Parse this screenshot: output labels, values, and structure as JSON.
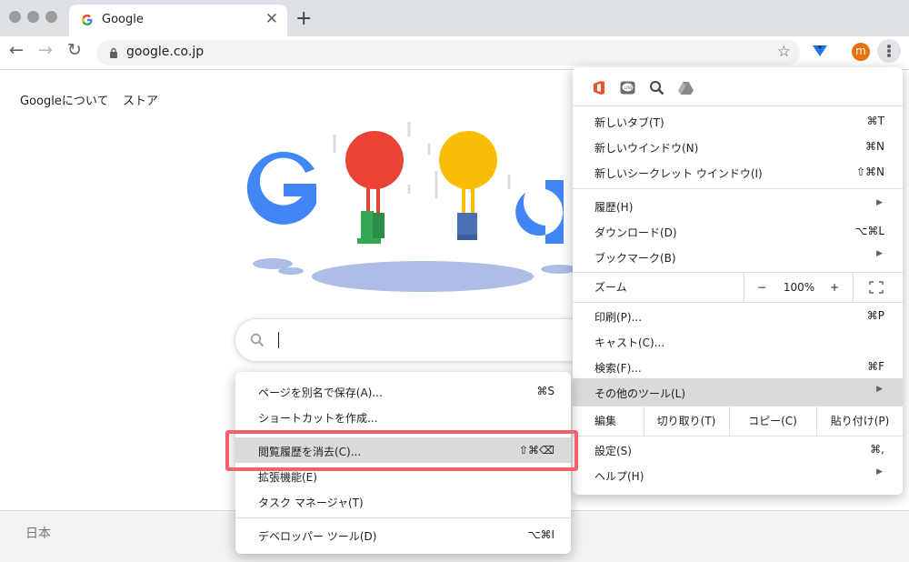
{
  "browser": {
    "tab": {
      "title": "Google",
      "close": "✕"
    },
    "new_tab": "+",
    "toolbar": {
      "back": "←",
      "forward": "→",
      "reload": "↻"
    },
    "omnibox": {
      "url": "google.co.jp",
      "star": "☆"
    },
    "avatar": "m"
  },
  "page": {
    "links": {
      "about": "Googleについて",
      "store": "ストア"
    },
    "footer": {
      "country": "日本"
    }
  },
  "chrome_menu": {
    "extension_icons": [
      "office-icon",
      "line-icon",
      "magnifier-icon",
      "drive-icon"
    ],
    "new_tab": {
      "label": "新しいタブ(T)",
      "shortcut": "⌘T"
    },
    "new_window": {
      "label": "新しいウインドウ(N)",
      "shortcut": "⌘N"
    },
    "new_incognito": {
      "label": "新しいシークレット ウインドウ(I)",
      "shortcut": "⇧⌘N"
    },
    "history": {
      "label": "履歴(H)"
    },
    "downloads": {
      "label": "ダウンロード(D)",
      "shortcut": "⌥⌘L"
    },
    "bookmarks": {
      "label": "ブックマーク(B)"
    },
    "zoom": {
      "label": "ズーム",
      "minus": "−",
      "value": "100%",
      "plus": "+"
    },
    "print": {
      "label": "印刷(P)...",
      "shortcut": "⌘P"
    },
    "cast": {
      "label": "キャスト(C)..."
    },
    "find": {
      "label": "検索(F)...",
      "shortcut": "⌘F"
    },
    "more_tools": {
      "label": "その他のツール(L)"
    },
    "edit": {
      "label": "編集",
      "cut": "切り取り(T)",
      "copy": "コピー(C)",
      "paste": "貼り付け(P)"
    },
    "settings": {
      "label": "設定(S)",
      "shortcut": "⌘,"
    },
    "help": {
      "label": "ヘルプ(H)"
    }
  },
  "more_tools_menu": {
    "save_page": {
      "label": "ページを別名で保存(A)...",
      "shortcut": "⌘S"
    },
    "create_shortcut": {
      "label": "ショートカットを作成..."
    },
    "clear_browsing_data": {
      "label": "閲覧履歴を消去(C)...",
      "shortcut": "⇧⌘⌫"
    },
    "extensions": {
      "label": "拡張機能(E)"
    },
    "task_manager": {
      "label": "タスク マネージャ(T)"
    },
    "developer_tools": {
      "label": "デベロッパー ツール(D)",
      "shortcut": "⌥⌘I"
    }
  },
  "colors": {
    "accent_highlight": "#f4606c",
    "hover_row": "#dadada",
    "avatar": "#e8710a"
  }
}
